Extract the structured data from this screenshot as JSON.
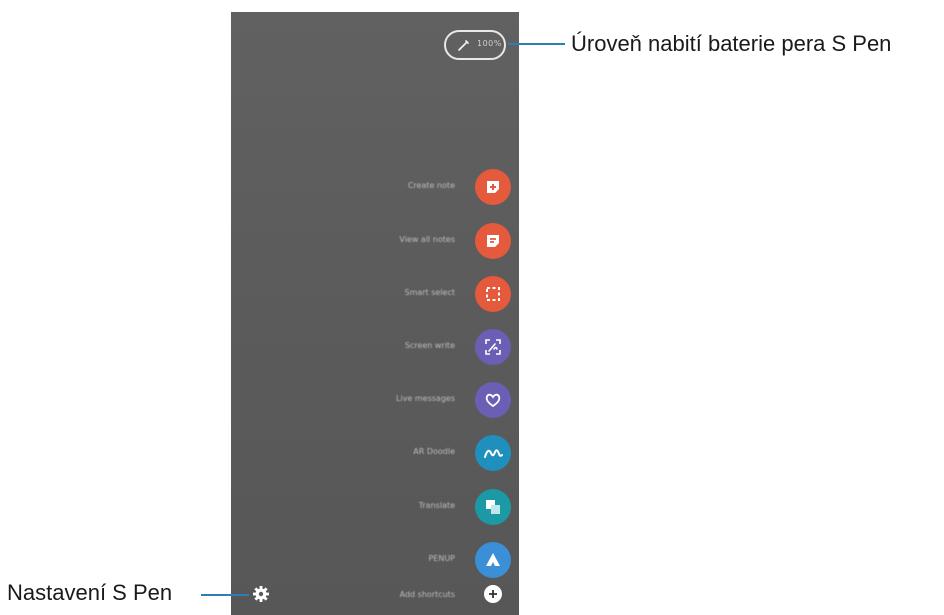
{
  "battery": {
    "level_text": "100%"
  },
  "menu": {
    "items": [
      {
        "label": "Create note",
        "color": "#e5593d",
        "icon": "note-plus-icon"
      },
      {
        "label": "View all notes",
        "color": "#e5593d",
        "icon": "notes-list-icon"
      },
      {
        "label": "Smart select",
        "color": "#e5593d",
        "icon": "smart-select-icon"
      },
      {
        "label": "Screen write",
        "color": "#6b5fb5",
        "icon": "screen-write-icon"
      },
      {
        "label": "Live messages",
        "color": "#6b5fb5",
        "icon": "heart-icon"
      },
      {
        "label": "AR Doodle",
        "color": "#1f8fbe",
        "icon": "doodle-icon"
      },
      {
        "label": "Translate",
        "color": "#1b9aa6",
        "icon": "translate-icon"
      },
      {
        "label": "PENUP",
        "color": "#3b8fd6",
        "icon": "penup-icon"
      }
    ],
    "add_label": "Add shortcuts"
  },
  "callouts": {
    "battery": "Úroveň nabití baterie pera S Pen",
    "settings": "Nastavení S Pen"
  },
  "colors": {
    "leader": "#2b7fb8",
    "screen": "#5e5e5e"
  }
}
